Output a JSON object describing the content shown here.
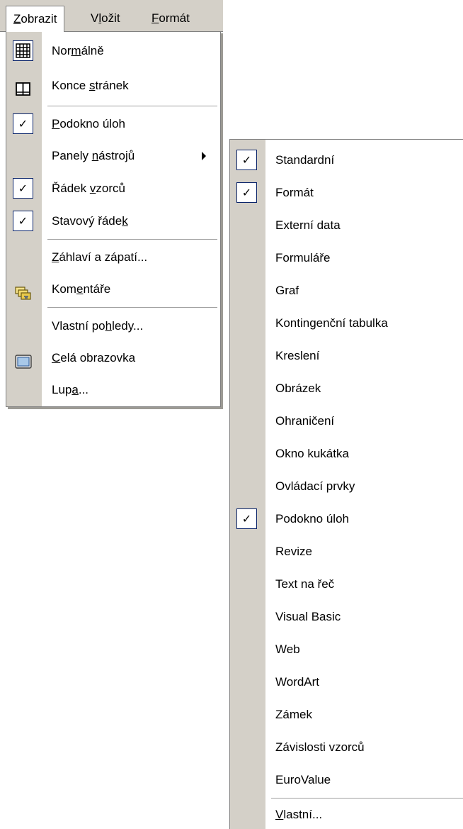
{
  "menubar": {
    "items": [
      {
        "pre": "",
        "u": "Z",
        "post": "obrazit"
      },
      {
        "pre": "V",
        "u": "l",
        "post": "ožit"
      },
      {
        "pre": "",
        "u": "F",
        "post": "ormát"
      }
    ]
  },
  "view_menu": {
    "items": [
      {
        "pre": "Nor",
        "u": "m",
        "post": "álně"
      },
      {
        "pre": "Konce ",
        "u": "s",
        "post": "tránek"
      },
      {
        "pre": "",
        "u": "P",
        "post": "odokno úloh"
      },
      {
        "pre": "Panely ",
        "u": "n",
        "post": "ástrojů"
      },
      {
        "pre": "Řádek ",
        "u": "v",
        "post": "zorců"
      },
      {
        "pre": "Stavový řáde",
        "u": "k",
        "post": ""
      },
      {
        "pre": "",
        "u": "Z",
        "post": "áhlaví a zápatí..."
      },
      {
        "pre": "Kom",
        "u": "e",
        "post": "ntáře"
      },
      {
        "pre": "Vlastní po",
        "u": "h",
        "post": "ledy..."
      },
      {
        "pre": "",
        "u": "C",
        "post": "elá obrazovka"
      },
      {
        "pre": "Lup",
        "u": "a",
        "post": "..."
      }
    ]
  },
  "toolbars_menu": {
    "items": [
      "Standardní",
      "Formát",
      "Externí data",
      "Formuláře",
      "Graf",
      "Kontingenční tabulka",
      "Kreslení",
      "Obrázek",
      "Ohraničení",
      "Okno kukátka",
      "Ovládací prvky",
      "Podokno úloh",
      "Revize",
      "Text na řeč",
      "Visual Basic",
      "Web",
      "WordArt",
      "Zámek",
      "Závislosti vzorců",
      "EuroValue"
    ],
    "custom": {
      "pre": "",
      "u": "V",
      "post": "lastní..."
    }
  },
  "check_glyph": "✓"
}
